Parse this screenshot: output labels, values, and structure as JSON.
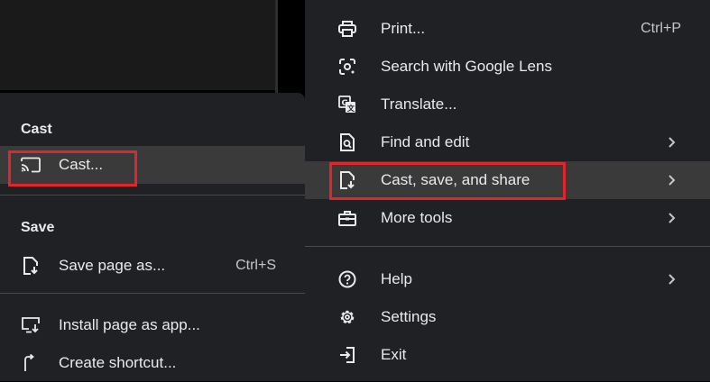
{
  "main_menu": {
    "items": [
      {
        "label": "Print...",
        "shortcut": "Ctrl+P",
        "icon": "printer-icon"
      },
      {
        "label": "Search with Google Lens",
        "icon": "google-lens-icon"
      },
      {
        "label": "Translate...",
        "icon": "translate-icon"
      },
      {
        "label": "Find and edit",
        "icon": "find-page-icon",
        "submenu": true
      },
      {
        "label": "Cast, save, and share",
        "icon": "file-download-icon",
        "submenu": true,
        "highlighted": true
      },
      {
        "label": "More tools",
        "icon": "toolbox-icon",
        "submenu": true
      },
      {
        "label": "Help",
        "icon": "help-icon",
        "submenu": true
      },
      {
        "label": "Settings",
        "icon": "gear-icon"
      },
      {
        "label": "Exit",
        "icon": "exit-icon"
      }
    ]
  },
  "sub_menu": {
    "cast_heading": "Cast",
    "cast_item": {
      "label": "Cast...",
      "icon": "cast-icon",
      "highlighted": true
    },
    "save_heading": "Save",
    "save_page": {
      "label": "Save page as...",
      "shortcut": "Ctrl+S",
      "icon": "save-page-icon"
    },
    "install_app": {
      "label": "Install page as app...",
      "icon": "install-app-icon"
    },
    "create_shortcut": {
      "label": "Create shortcut...",
      "icon": "shortcut-icon"
    }
  },
  "colors": {
    "menu_bg": "#202124",
    "highlight_bg": "#3a3a3a",
    "annotation_red": "#e0252b",
    "text": "#e8eaed"
  }
}
